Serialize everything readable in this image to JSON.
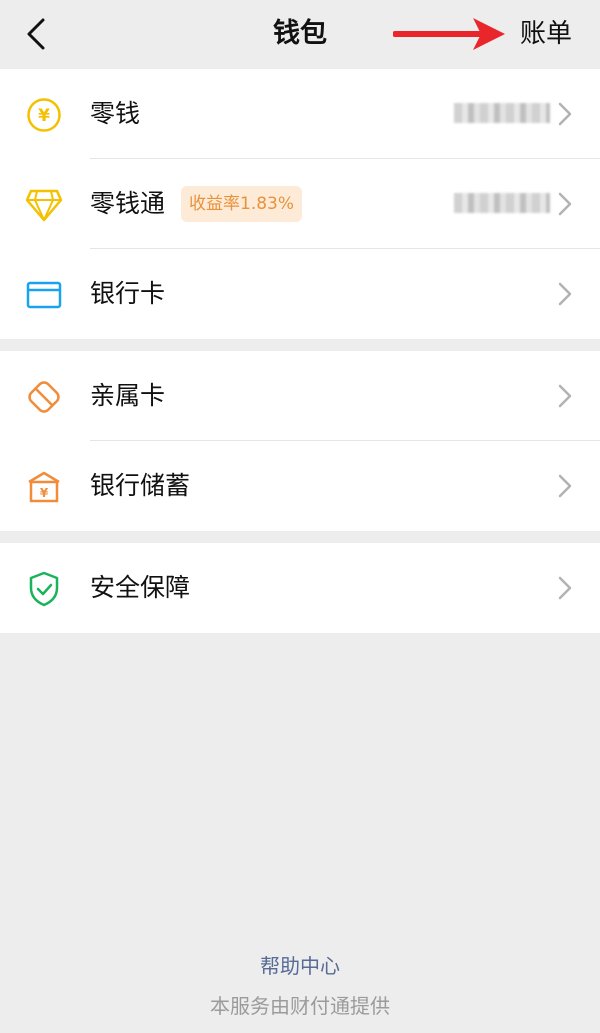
{
  "header": {
    "title": "钱包",
    "bill_label": "账单",
    "back_icon": "chevron-left-icon",
    "annotation_color": "#e8262b"
  },
  "groups": [
    {
      "items": [
        {
          "label": "零钱",
          "icon": "yuan-coin-icon",
          "icon_color": "#f5c000",
          "value": "masked"
        },
        {
          "label": "零钱通",
          "icon": "diamond-icon",
          "icon_color": "#f5c000",
          "badge": "收益率1.83%",
          "value": "masked"
        },
        {
          "label": "银行卡",
          "icon": "card-icon",
          "icon_color": "#1aa1f0"
        }
      ]
    },
    {
      "items": [
        {
          "label": "亲属卡",
          "icon": "family-card-icon",
          "icon_color": "#f08c3a"
        },
        {
          "label": "银行储蓄",
          "icon": "bank-savings-icon",
          "icon_color": "#f08c3a"
        }
      ]
    },
    {
      "items": [
        {
          "label": "安全保障",
          "icon": "shield-check-icon",
          "icon_color": "#18b35a"
        }
      ]
    }
  ],
  "footer": {
    "help_label": "帮助中心",
    "provider_note": "本服务由财付通提供"
  }
}
